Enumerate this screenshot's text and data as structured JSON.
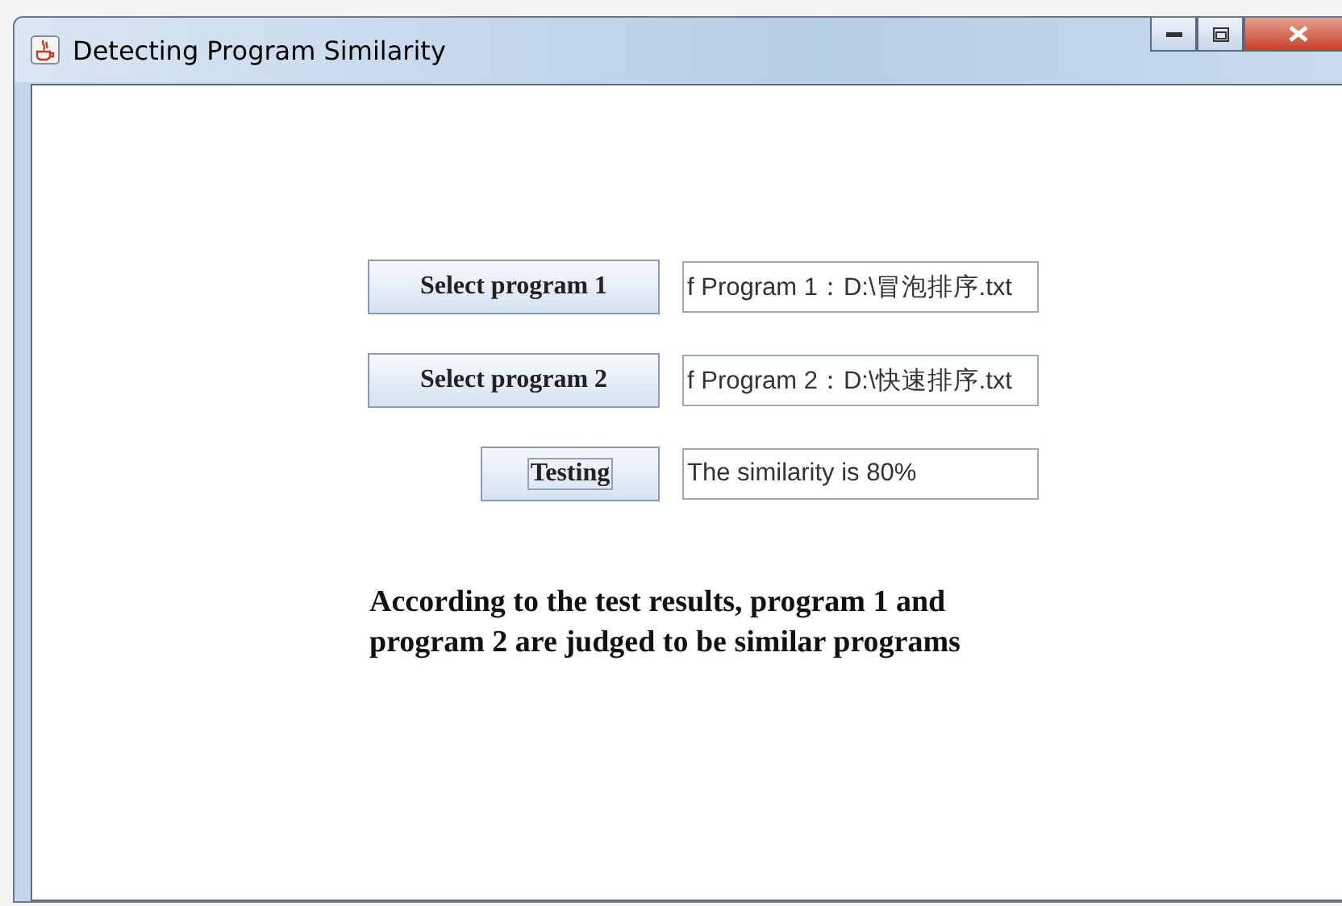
{
  "window": {
    "title": "Detecting Program Similarity"
  },
  "rows": [
    {
      "button": "Select program 1",
      "field": "f Program 1：D:\\冒泡排序.txt",
      "focused": false,
      "wide": true
    },
    {
      "button": "Select program 2",
      "field": "f Program 2：D:\\快速排序.txt",
      "focused": false,
      "wide": true
    },
    {
      "button": "Testing",
      "field": "The similarity is 80%",
      "focused": true,
      "wide": false
    }
  ],
  "result": "According to the test results, program 1 and program 2 are judged to be similar programs"
}
